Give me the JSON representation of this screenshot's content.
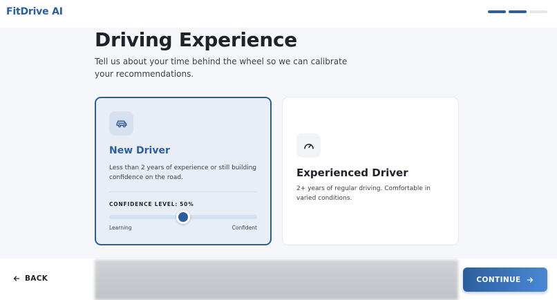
{
  "header": {
    "brand": "FitDrive AI",
    "progress_steps": [
      {
        "done": true
      },
      {
        "done": true
      },
      {
        "done": false
      }
    ]
  },
  "main": {
    "title": "Driving Experience",
    "subtitle": "Tell us about your time behind the wheel so we can calibrate your recommendations."
  },
  "options": [
    {
      "title": "New Driver",
      "description": "Less than 2 years of experience or still building confidence on the road.",
      "icon": "car-icon",
      "selected": true,
      "confidence": {
        "label": "CONFIDENCE LEVEL:",
        "value_text": "50%",
        "value": 50,
        "min_label": "Learning",
        "max_label": "Confident"
      }
    },
    {
      "title": "Experienced Driver",
      "description": "2+ years of regular driving. Comfortable in varied conditions.",
      "icon": "speedometer-icon",
      "selected": false
    }
  ],
  "footer": {
    "back_label": "BACK",
    "continue_label": "CONTINUE"
  },
  "colors": {
    "accent": "#2c5e9e",
    "accent_light": "#4a88d4",
    "selected_card_bg": "#e9eef6",
    "track": "#d3e0f5"
  }
}
